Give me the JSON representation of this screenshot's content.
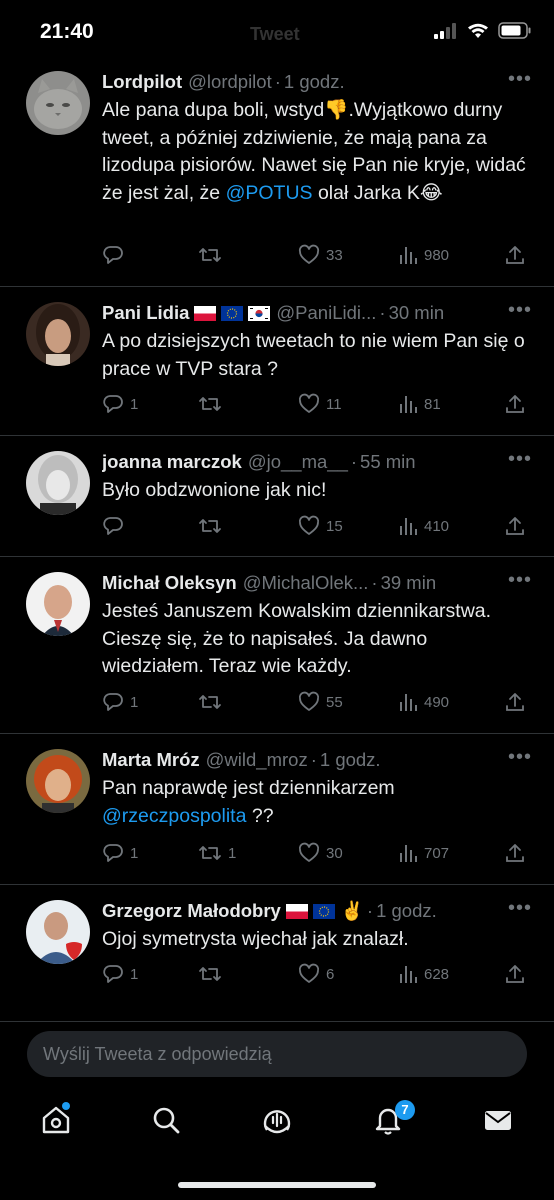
{
  "status": {
    "time": "21:40"
  },
  "header": {
    "ghost_title": "Tweet"
  },
  "tweets": [
    {
      "name": "Lordpilot",
      "handle": "@lordpilot",
      "time": "1 godz.",
      "text_html": "Ale pana dupa boli, wstyd👎.Wyjątkowo durny tweet, a później zdziwienie, że mają pana za lizodupa pisiorów. Nawet się Pan nie kryje, widać że jest żal, że <span class=\"mention\">@POTUS</span> olał Jarka K😂",
      "replies": "",
      "retweets": "",
      "likes": "33",
      "views": "980"
    },
    {
      "name": "Pani Lidia",
      "handle": "@PaniLidi...",
      "time": "30 min",
      "text_html": "A po dzisiejszych tweetach to nie wiem Pan się o prace w TVP stara ?",
      "replies": "1",
      "retweets": "",
      "likes": "11",
      "views": "81"
    },
    {
      "name": "joanna marczok",
      "handle": "@jo__ma__",
      "time": "55 min",
      "text_html": "Było obdzwonione jak nic!",
      "replies": "",
      "retweets": "",
      "likes": "15",
      "views": "410"
    },
    {
      "name": "Michał Oleksyn",
      "handle": "@MichalOlek...",
      "time": "39 min",
      "text_html": "Jesteś Januszem Kowalskim dziennikarstwa. Cieszę się, że to napisałeś. Ja dawno wiedziałem. Teraz wie każdy.",
      "replies": "1",
      "retweets": "",
      "likes": "55",
      "views": "490"
    },
    {
      "name": "Marta Mróz",
      "handle": "@wild_mroz",
      "time": "1 godz.",
      "text_html": "Pan naprawdę jest dziennikarzem <span class=\"mention\">@rzeczpospolita</span> ??",
      "replies": "1",
      "retweets": "1",
      "likes": "30",
      "views": "707"
    },
    {
      "name": "Grzegorz Małodobry",
      "handle": "",
      "time": "1 godz.",
      "text_html": "Ojoj symetrysta wjechał jak znalazł.",
      "replies": "1",
      "retweets": "",
      "likes": "6",
      "views": "628"
    }
  ],
  "reply_box": {
    "placeholder": "Wyślij Tweeta z odpowiedzią"
  },
  "tabbar": {
    "notifications_badge": "7"
  },
  "colors": {
    "accent": "#1d9bf0",
    "secondary_text": "#71767b",
    "divider": "#2f3336"
  },
  "icons": [
    "reply-icon",
    "retweet-icon",
    "like-icon",
    "views-icon",
    "share-icon",
    "more-icon",
    "home-icon",
    "search-icon",
    "spaces-icon",
    "notifications-icon",
    "messages-icon"
  ]
}
